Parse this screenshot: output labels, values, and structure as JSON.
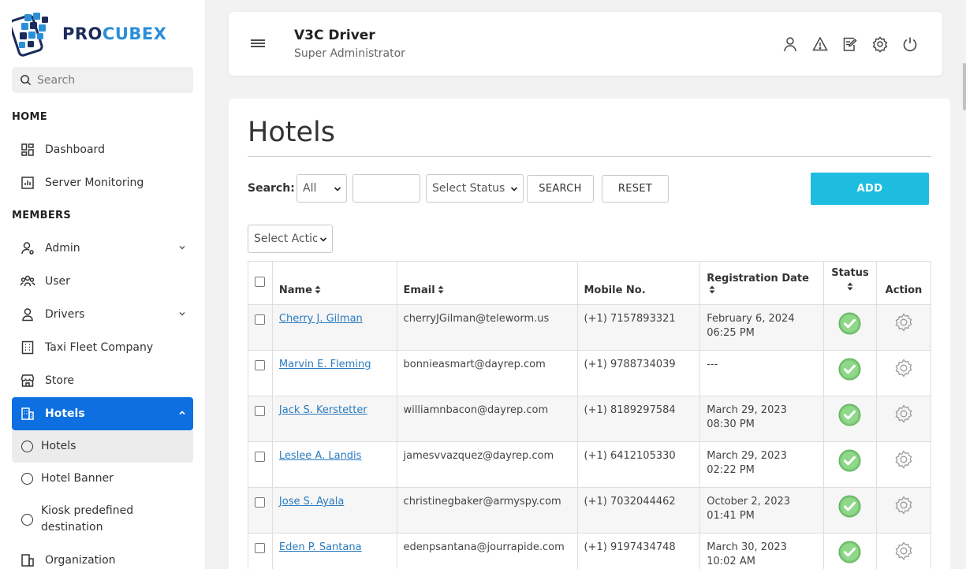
{
  "brand": {
    "name_part1": "PRO",
    "name_part2": "CUBEX",
    "colors": {
      "dark": "#1b2c5c",
      "light": "#2b8fd8"
    }
  },
  "sidebar": {
    "search_placeholder": "Search",
    "sections": {
      "home": "HOME",
      "members": "MEMBERS"
    },
    "items": {
      "dashboard": "Dashboard",
      "server_monitoring": "Server Monitoring",
      "admin": "Admin",
      "user": "User",
      "drivers": "Drivers",
      "taxi_fleet": "Taxi Fleet Company",
      "store": "Store",
      "hotels": "Hotels",
      "organization": "Organization"
    },
    "sub_items": {
      "hotels": "Hotels",
      "hotel_banner": "Hotel Banner",
      "kiosk": "Kiosk predefined destination"
    },
    "active_color": "#0d6fe0"
  },
  "header": {
    "title": "V3C Driver",
    "subtitle": "Super Administrator",
    "icons": [
      "user-icon",
      "alert-icon",
      "edit-icon",
      "settings-icon",
      "power-icon"
    ]
  },
  "main": {
    "title": "Hotels",
    "search_label": "Search:",
    "filter_select": "All",
    "search_value": "",
    "status_select": "Select Status",
    "search_button": "SEARCH",
    "reset_button": "RESET",
    "add_button": "ADD",
    "action_select": "Select Action",
    "add_color": "#1ebde0"
  },
  "table": {
    "columns": {
      "name": "Name",
      "email": "Email",
      "mobile": "Mobile No.",
      "reg_date": "Registration Date",
      "status": "Status",
      "action": "Action"
    },
    "rows": [
      {
        "name": "Cherry J. Gilman",
        "email": "cherryJGilman@teleworm.us",
        "mobile": "(+1) 7157893321",
        "date": "February 6, 2024 06:25 PM"
      },
      {
        "name": "Marvin E. Fleming",
        "email": "bonnieasmart@dayrep.com",
        "mobile": "(+1) 9788734039",
        "date": "---"
      },
      {
        "name": "Jack S. Kerstetter",
        "email": "williamnbacon@dayrep.com",
        "mobile": "(+1) 8189297584",
        "date": "March 29, 2023 08:30 PM"
      },
      {
        "name": "Leslee A. Landis",
        "email": "jamesvvazquez@dayrep.com",
        "mobile": "(+1) 6412105330",
        "date": "March 29, 2023 02:22 PM"
      },
      {
        "name": "Jose S. Ayala",
        "email": "christinegbaker@armyspy.com",
        "mobile": "(+1) 7032044462",
        "date": "October 2, 2023 01:41 PM"
      },
      {
        "name": "Eden P. Santana",
        "email": "edenpsantana@jourrapide.com",
        "mobile": "(+1) 9197434748",
        "date": "March 30, 2023 10:02 AM"
      }
    ]
  }
}
